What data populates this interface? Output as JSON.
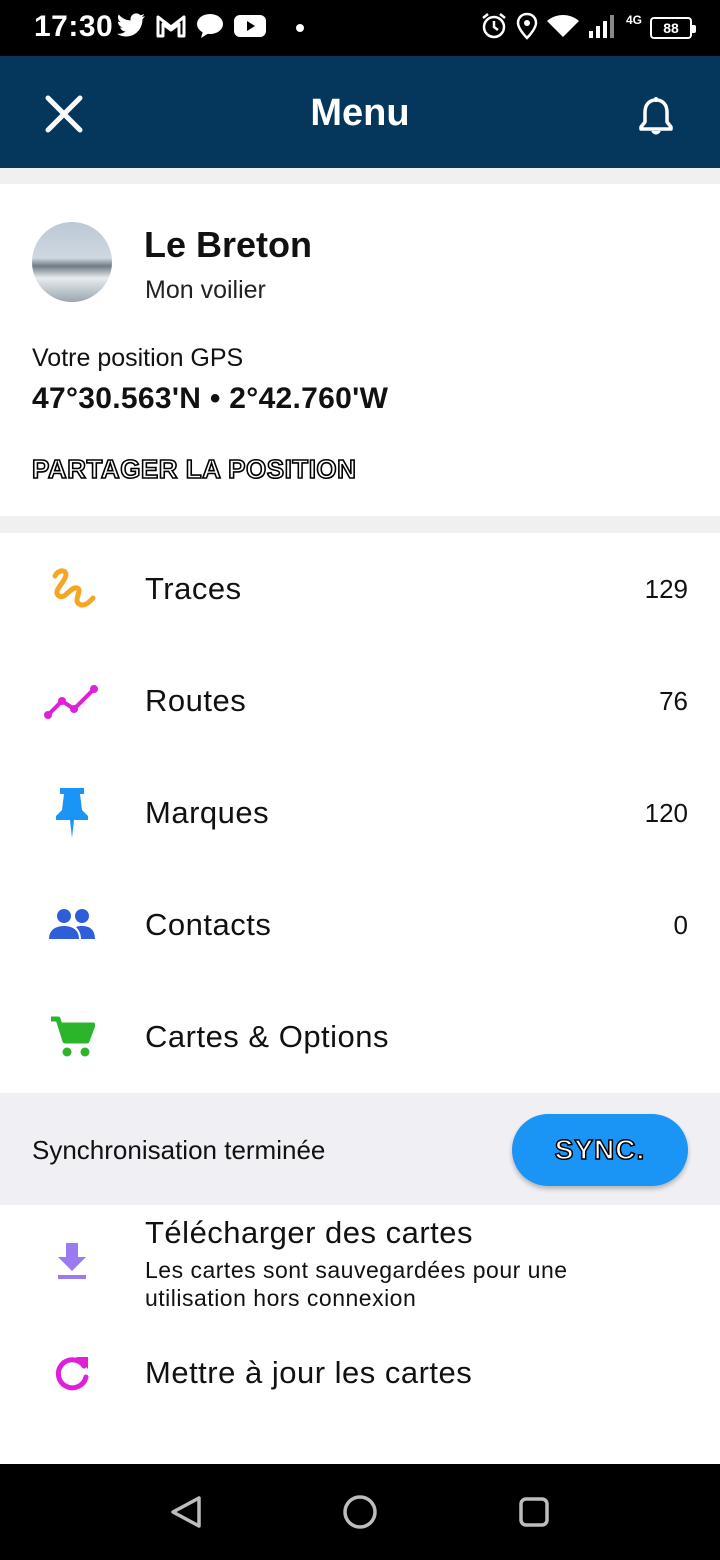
{
  "status_bar": {
    "time": "17:30",
    "network": "4G",
    "battery": "88",
    "left_icons": [
      "twitter-icon",
      "gmail-icon",
      "chat-icon",
      "youtube-icon"
    ],
    "right_icons": [
      "alarm-icon",
      "location-icon",
      "wifi-icon",
      "signal-icon",
      "battery-icon"
    ]
  },
  "app_bar": {
    "title": "Menu",
    "close_icon": "close-icon",
    "bell_icon": "bell-icon",
    "background": "#04375b"
  },
  "profile": {
    "boat_name": "Le Breton",
    "boat_type": "Mon voilier",
    "gps_label": "Votre position GPS",
    "gps_value": "47°30.563'N • 2°42.760'W",
    "share_label": "PARTAGER LA POSITION"
  },
  "menu": {
    "items": [
      {
        "label": "Traces",
        "count": "129",
        "icon": "trace-icon",
        "color": "#f5a623"
      },
      {
        "label": "Routes",
        "count": "76",
        "icon": "route-icon",
        "color": "#e020d8"
      },
      {
        "label": "Marques",
        "count": "120",
        "icon": "pin-icon",
        "color": "#1a94f5"
      },
      {
        "label": "Contacts",
        "count": "0",
        "icon": "contacts-icon",
        "color": "#2f5fd8"
      },
      {
        "label": "Cartes & Options",
        "count": "",
        "icon": "cart-icon",
        "color": "#2bb52b"
      }
    ]
  },
  "sync": {
    "status": "Synchronisation terminée",
    "button_label": "SYNC.",
    "button_color": "#1a94f5"
  },
  "downloads": {
    "download_title": "Télécharger des cartes",
    "download_subtitle": "Les cartes sont sauvegardées pour une utilisation hors connexion",
    "download_icon_color": "#9a7cf0",
    "update_title": "Mettre à jour les cartes",
    "update_icon_color": "#e020d8"
  },
  "nav_bar": {
    "back_icon": "back-triangle-icon",
    "home_icon": "home-circle-icon",
    "recents_icon": "recents-square-icon"
  }
}
